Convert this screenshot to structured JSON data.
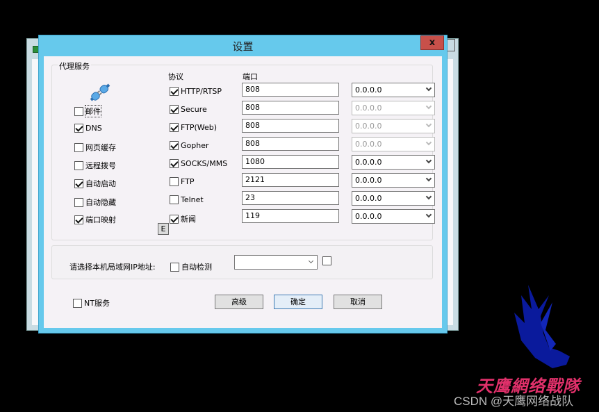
{
  "dialog": {
    "title": "设置",
    "close_label": "x"
  },
  "proxy_group": {
    "legend": "代理服务",
    "protocol_header": "协议",
    "port_header": "端口",
    "services": [
      {
        "label": "邮件",
        "checked": false,
        "focused": true
      },
      {
        "label": "DNS",
        "checked": true
      },
      {
        "label": "网页缓存",
        "checked": false
      },
      {
        "label": "远程拨号",
        "checked": false
      },
      {
        "label": "自动启动",
        "checked": true
      },
      {
        "label": "自动隐藏",
        "checked": false
      },
      {
        "label": "端口映射",
        "checked": true
      }
    ],
    "e_button_label": "E",
    "protocols": [
      {
        "label": "HTTP/RTSP",
        "checked": true,
        "port": "808",
        "ip": "0.0.0.0",
        "ip_enabled": true
      },
      {
        "label": "Secure",
        "checked": true,
        "port": "808",
        "ip": "0.0.0.0",
        "ip_enabled": false
      },
      {
        "label": "FTP(Web)",
        "checked": true,
        "port": "808",
        "ip": "0.0.0.0",
        "ip_enabled": false
      },
      {
        "label": "Gopher",
        "checked": true,
        "port": "808",
        "ip": "0.0.0.0",
        "ip_enabled": false
      },
      {
        "label": "SOCKS/MMS",
        "checked": true,
        "port": "1080",
        "ip": "0.0.0.0",
        "ip_enabled": true
      },
      {
        "label": "FTP",
        "checked": false,
        "port": "2121",
        "ip": "0.0.0.0",
        "ip_enabled": true
      },
      {
        "label": "Telnet",
        "checked": false,
        "port": "23",
        "ip": "0.0.0.0",
        "ip_enabled": true
      },
      {
        "label": "新闻",
        "checked": true,
        "port": "119",
        "ip": "0.0.0.0",
        "ip_enabled": true
      }
    ]
  },
  "ip_group": {
    "label": "请选择本机局域网IP地址:",
    "auto_detect_label": "自动检测",
    "auto_detect_checked": false,
    "ip_value": "",
    "extra_checked": false
  },
  "footer": {
    "nt_service_label": "NT服务",
    "nt_service_checked": false,
    "advanced_label": "高级",
    "ok_label": "确定",
    "cancel_label": "取消"
  },
  "watermark": {
    "brand": "天鹰網络戰隊",
    "csdn": "CSDN @天鹰网络战队"
  },
  "colors": {
    "titlebar": "#66c9ec",
    "close_button": "#c7504a",
    "client_bg": "#f5f2f6",
    "brand_text": "#e0306a",
    "eagle": "#0a1a9c"
  }
}
